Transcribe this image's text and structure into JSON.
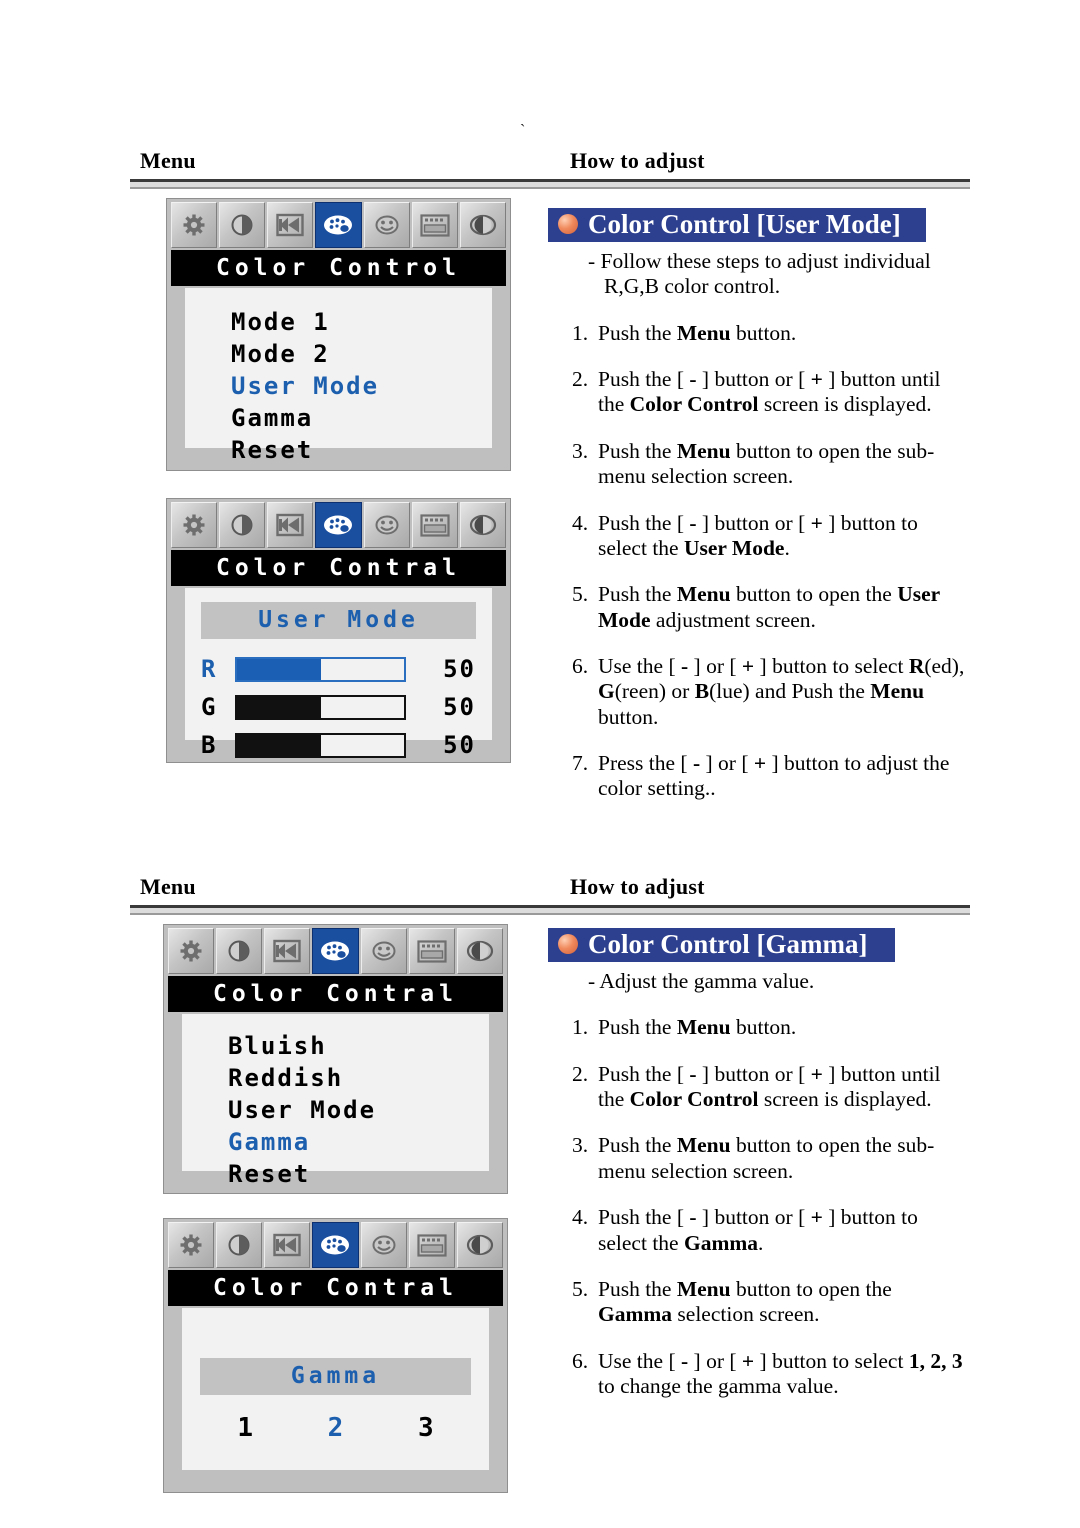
{
  "page": {
    "stray_mark": "`"
  },
  "sections": [
    {
      "header": {
        "menu_label": "Menu",
        "how_label": "How to adjust"
      },
      "banner": {
        "title": "Color Control [User Mode]",
        "bullet_color": "#f08a5d",
        "bg_color": "#2d3f8f"
      },
      "intro": "-  Follow these steps to adjust individual R,G,B color control.",
      "steps": [
        {
          "num": "1.",
          "html": "Push the <b>Menu</b> button."
        },
        {
          "num": "2.",
          "html": "Push the [ <b>-</b> ]  button or [ <b>+</b> ]  button until the <b>Color Control</b> screen is displayed."
        },
        {
          "num": "3.",
          "html": "Push the <b>Menu</b> button to open the sub-menu selection screen."
        },
        {
          "num": "4.",
          "html": "Push the [ <b>-</b> ]  button or [ <b>+</b> ] button to select the <b>User Mode</b>."
        },
        {
          "num": "5.",
          "html": "Push the <b>Menu</b> button to open the <b>User Mode</b> adjustment screen."
        },
        {
          "num": "6.",
          "html": "Use the [ <b>-</b> ]  or [ <b>+</b> ] button to select <b>R</b>(ed), <b>G</b>(reen) or <b>B</b>(lue) and Push the <b>Menu</b> button."
        },
        {
          "num": "7.",
          "html": "Press the [ <b>-</b> ]  or [ <b>+</b> ]  button to adjust the color setting.."
        }
      ],
      "osds": [
        {
          "title": "Color Control",
          "icons": [
            "brightness-icon",
            "contrast-icon",
            "position-icon",
            "palette-icon",
            "smiley-icon",
            "osd-box-icon",
            "sharpness-icon"
          ],
          "selected_icon_index": 3,
          "type": "list",
          "items": [
            {
              "label": "Mode 1",
              "highlighted": false
            },
            {
              "label": "Mode 2",
              "highlighted": false
            },
            {
              "label": "User Mode",
              "highlighted": true
            },
            {
              "label": "Gamma",
              "highlighted": false
            },
            {
              "label": "Reset",
              "highlighted": false
            }
          ]
        },
        {
          "title": "Color Contral",
          "icons": [
            "brightness-icon",
            "contrast-icon",
            "position-icon",
            "palette-icon",
            "smiley-icon",
            "osd-box-icon",
            "sharpness-icon"
          ],
          "selected_icon_index": 3,
          "type": "sliders",
          "heading": "User Mode",
          "sliders": [
            {
              "channel": "R",
              "value": "50",
              "percent": 50,
              "active": true
            },
            {
              "channel": "G",
              "value": "50",
              "percent": 50,
              "active": false
            },
            {
              "channel": "B",
              "value": "50",
              "percent": 50,
              "active": false
            }
          ]
        }
      ]
    },
    {
      "header": {
        "menu_label": "Menu",
        "how_label": "How to adjust"
      },
      "banner": {
        "title": "Color Control [Gamma]",
        "bullet_color": "#f08a5d",
        "bg_color": "#2d3f8f"
      },
      "intro": "-  Adjust the gamma value.",
      "steps": [
        {
          "num": "1.",
          "html": "Push the <b>Menu</b> button."
        },
        {
          "num": "2.",
          "html": "Push the [ <b>-</b> ]  button or [ <b>+</b> ]  button until the <b>Color Control</b> screen is displayed."
        },
        {
          "num": "3.",
          "html": "Push the <b>Menu</b> button to open the sub-menu selection screen."
        },
        {
          "num": "4.",
          "html": "Push the [ <b>-</b> ]  button or [ <b>+</b> ]  button to select the <b>Gamma</b>."
        },
        {
          "num": "5.",
          "html": "Push the <b>Menu</b> button to open the <b>Gamma</b> selection screen."
        },
        {
          "num": "6.",
          "html": "Use the [ <b>-</b> ]  or [ <b>+</b> ] button to select <b>1, 2, 3</b> to change the gamma value."
        }
      ],
      "osds": [
        {
          "title": "Color Contral",
          "icons": [
            "brightness-icon",
            "contrast-icon",
            "position-icon",
            "palette-icon",
            "smiley-icon",
            "osd-box-icon",
            "sharpness-icon"
          ],
          "selected_icon_index": 3,
          "type": "list",
          "items": [
            {
              "label": "Bluish",
              "highlighted": false
            },
            {
              "label": "Reddish",
              "highlighted": false
            },
            {
              "label": "User Mode",
              "highlighted": false
            },
            {
              "label": "Gamma",
              "highlighted": true
            },
            {
              "label": "Reset",
              "highlighted": false
            }
          ]
        },
        {
          "title": "Color Contral",
          "icons": [
            "brightness-icon",
            "contrast-icon",
            "position-icon",
            "palette-icon",
            "smiley-icon",
            "osd-box-icon",
            "sharpness-icon"
          ],
          "selected_icon_index": 3,
          "type": "gamma",
          "heading": "Gamma",
          "options": [
            {
              "label": "1",
              "highlighted": false
            },
            {
              "label": "2",
              "highlighted": true
            },
            {
              "label": "3",
              "highlighted": false
            }
          ]
        }
      ]
    }
  ]
}
